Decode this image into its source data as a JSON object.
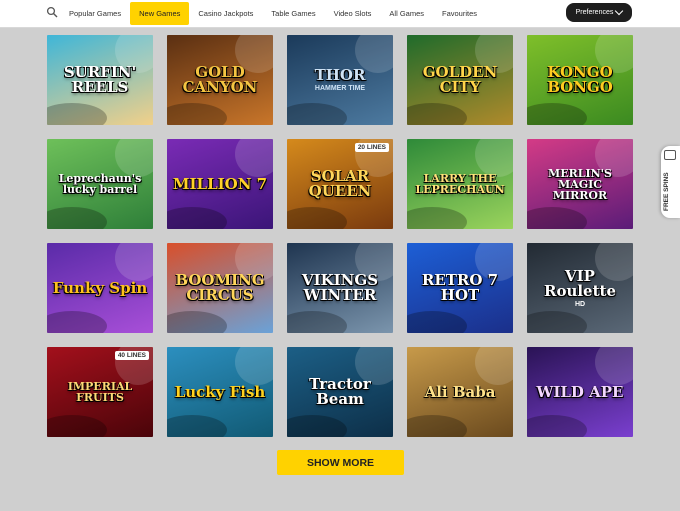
{
  "nav": {
    "items": [
      {
        "label": "Popular Games",
        "active": false
      },
      {
        "label": "New Games",
        "active": true
      },
      {
        "label": "Casino Jackpots",
        "active": false
      },
      {
        "label": "Table Games",
        "active": false
      },
      {
        "label": "Video Slots",
        "active": false
      },
      {
        "label": "All Games",
        "active": false
      },
      {
        "label": "Favourites",
        "active": false
      }
    ],
    "preferences_label": "Preferences"
  },
  "games": [
    {
      "title": "SURFIN' REELS",
      "bg": "#3fb6d8",
      "bg2": "#f2d089",
      "color": "#ffffff",
      "icon": "van-icon"
    },
    {
      "title": "GOLD CANYON",
      "bg": "#5a2f12",
      "bg2": "#c9762a",
      "color": "#f5c542",
      "icon": "cowboy-icon"
    },
    {
      "title": "THOR",
      "sub": "HAMMER TIME",
      "bg": "#1b3a5a",
      "bg2": "#4d7aa0",
      "color": "#cfe3f5",
      "icon": "viking-icon"
    },
    {
      "title": "GOLDEN CITY",
      "bg": "#1f6b2b",
      "bg2": "#b08a2b",
      "color": "#ffd54a",
      "icon": "aztec-icon"
    },
    {
      "title": "KONGO BONGO",
      "bg": "#7fbf2a",
      "bg2": "#3b8a21",
      "color": "#ffcc1f",
      "icon": "monkey-icon"
    },
    {
      "title": "Leprechaun's lucky barrel",
      "bg": "#6ec05a",
      "bg2": "#2e7f39",
      "color": "#ffffff",
      "icon": "barrel-icon"
    },
    {
      "title": "MILLION 7",
      "bg": "#7a2bb5",
      "bg2": "#3b1578",
      "color": "#ffd12a",
      "icon": "fruit-icon"
    },
    {
      "title": "SOLAR QUEEN",
      "badge": "20 LINES",
      "bg": "#d58a1c",
      "bg2": "#7a3a0e",
      "color": "#ffd75a",
      "icon": "queen-icon"
    },
    {
      "title": "LARRY THE LEPRECHAUN",
      "bg": "#2e8a39",
      "bg2": "#9bd45d",
      "color": "#ffe27a",
      "icon": "coin-icon"
    },
    {
      "title": "MERLIN'S MAGIC MIRROR",
      "bg": "#d43b86",
      "bg2": "#5a1c78",
      "color": "#ffffff",
      "icon": "wizard-icon"
    },
    {
      "title": "Funky Spin",
      "bg": "#5a2ba8",
      "bg2": "#a84fd8",
      "color": "#ffc21e",
      "icon": "star-icon"
    },
    {
      "title": "BOOMING CIRCUS",
      "bg": "#d94f2a",
      "bg2": "#6aa2d8",
      "color": "#ffd55a",
      "icon": "tent-icon"
    },
    {
      "title": "VIKINGS WINTER",
      "bg": "#1f3550",
      "bg2": "#7b95ad",
      "color": "#ffffff",
      "icon": "viking-icon"
    },
    {
      "title": "RETRO 7 HOT",
      "bg": "#1d5fd6",
      "bg2": "#1b2f8a",
      "color": "#ffffff",
      "icon": "seven-icon"
    },
    {
      "title": "VIP Roulette",
      "sub": "HD",
      "bg": "#222a33",
      "bg2": "#5a6877",
      "color": "#ffffff",
      "icon": "roulette-icon"
    },
    {
      "title": "IMPERIAL FRUITS",
      "badge": "40 LINES",
      "bg": "#a3101c",
      "bg2": "#4a0409",
      "color": "#ffd977",
      "icon": "crown-icon"
    },
    {
      "title": "Lucky Fish",
      "bg": "#2c8fbf",
      "bg2": "#115a74",
      "color": "#ffd21f",
      "icon": "fish-icon"
    },
    {
      "title": "Tractor Beam",
      "bg": "#1c5f86",
      "bg2": "#0d2f48",
      "color": "#ffffff",
      "icon": "cow-icon"
    },
    {
      "title": "Ali Baba",
      "bg": "#c79a4a",
      "bg2": "#6b4a1e",
      "color": "#ffe28a",
      "icon": "lamp-icon"
    },
    {
      "title": "WILD APE",
      "bg": "#2a1355",
      "bg2": "#7a3fcf",
      "color": "#f3d6ff",
      "icon": "ape-icon"
    }
  ],
  "show_more_label": "SHOW MORE",
  "free_spins_label": "FREE SPINS"
}
